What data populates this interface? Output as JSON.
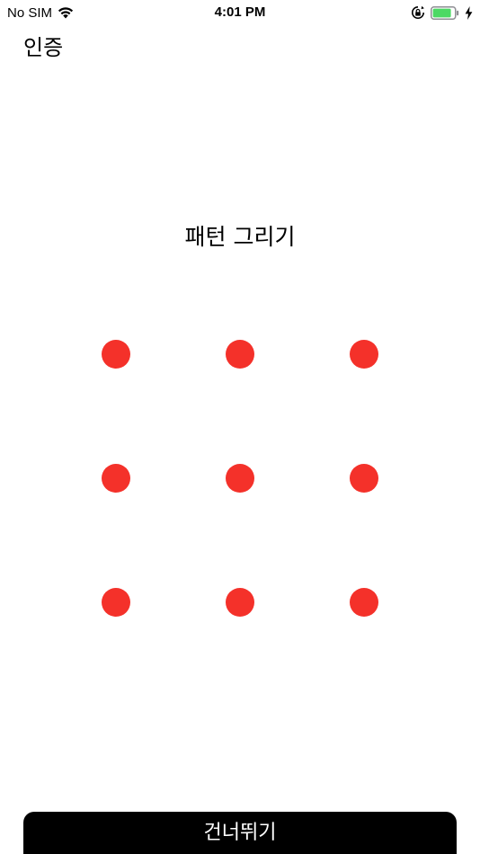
{
  "status_bar": {
    "carrier": "No SIM",
    "time": "4:01 PM",
    "icons": [
      "wifi-icon",
      "rotation-lock-icon",
      "battery-icon",
      "charging-icon"
    ],
    "battery_color": "#4cd964"
  },
  "nav": {
    "title": "인증"
  },
  "pattern": {
    "heading": "패턴 그리기",
    "dot_color": "#f4312a",
    "rows": 3,
    "columns": 3
  },
  "actions": {
    "skip_label": "건너뛰기"
  }
}
